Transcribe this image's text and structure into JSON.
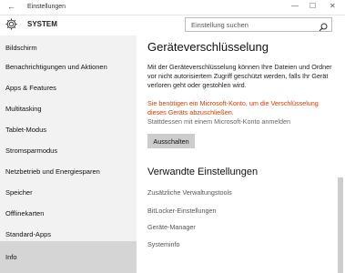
{
  "window": {
    "title": "Einstellungen",
    "back_glyph": "←",
    "minimize_glyph": "—",
    "maximize_glyph": "☐",
    "close_glyph": "✕"
  },
  "header": {
    "icon": "gear-icon",
    "title": "SYSTEM"
  },
  "search": {
    "placeholder": "Einstellung suchen",
    "icon": "search-icon"
  },
  "sidebar": {
    "items": [
      {
        "label": "Bildschirm"
      },
      {
        "label": "Benachrichtigungen und Aktionen"
      },
      {
        "label": "Apps & Features"
      },
      {
        "label": "Multitasking"
      },
      {
        "label": "Tablet-Modus"
      },
      {
        "label": "Stromsparmodus"
      },
      {
        "label": "Netzbetrieb und Energiesparen"
      },
      {
        "label": "Speicher"
      },
      {
        "label": "Offlinekarten"
      },
      {
        "label": "Standard-Apps"
      },
      {
        "label": "Info"
      }
    ],
    "active_index": 10
  },
  "main": {
    "title": "Geräteverschlüsselung",
    "description": "Mit der Geräteverschlüsselung können Ihre Dateien und Ordner vor nicht autorisiertem Zugriff geschützt werden, falls Ihr Gerät verloren geht oder gestohlen wird.",
    "warning": "Sie benötigen ein Microsoft-Konto, um die Verschlüsselung dieses Geräts abzuschließen.",
    "alt_link": "Stattdessen mit einem Microsoft-Konto anmelden",
    "button_label": "Ausschalten",
    "related_title": "Verwandte Einstellungen",
    "related_links": [
      {
        "label": "Zusätzliche Verwaltungstools"
      },
      {
        "label": "BitLocker-Einstellungen"
      },
      {
        "label": "Geräte-Manager"
      },
      {
        "label": "Systeminfo"
      }
    ]
  },
  "colors": {
    "warning": "#d83b01",
    "sidebar_bg": "#f2f2f2",
    "active_item_bg": "#d5d5d5",
    "button_bg": "#cccccc"
  }
}
